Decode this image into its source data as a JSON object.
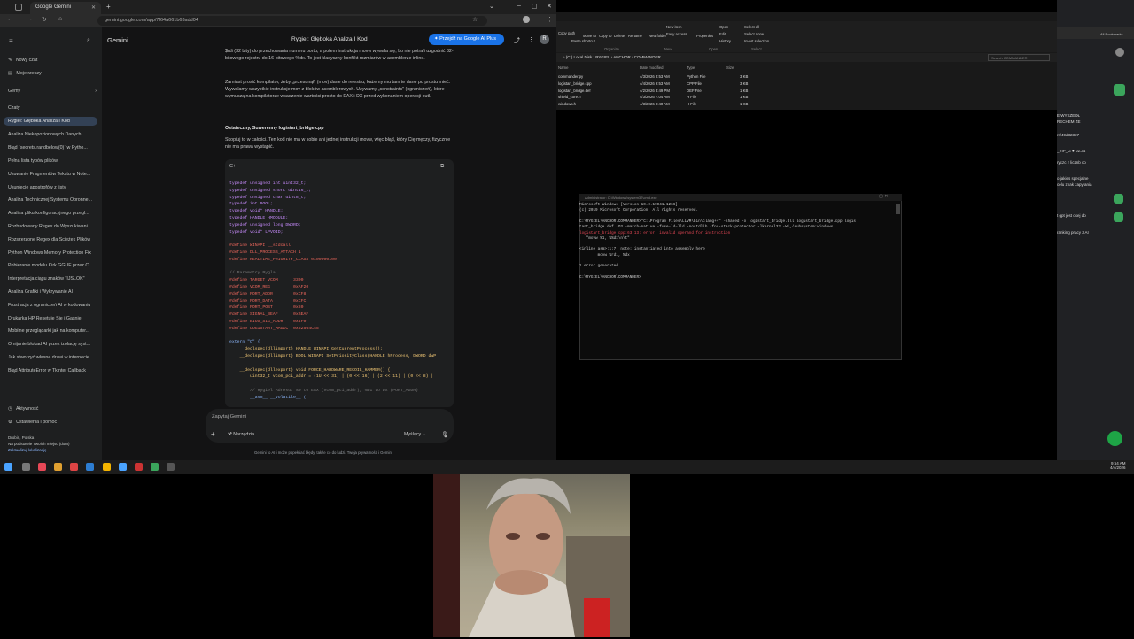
{
  "chrome": {
    "tab_title": "Google Gemini",
    "url": "gemini.google.com/app/7f64a661b63add04",
    "app_name": "Gemini",
    "chat_title": "Rygiel: Głęboka Analiza I Kod",
    "upgrade_button": "Przejdź na Google AI Plus",
    "avatar_letter": "R"
  },
  "sidebar": {
    "new_chat": "Nowy czat",
    "my_stuff": "Moje rzeczy",
    "gems_label": "Gemy",
    "chats_label": "Czaty",
    "chats": [
      "Rygiel: Głęboka Analiza I Kod",
      "Analiza Niekopozionowych Danych",
      "Błąd `secrets.randbelow(0)` w Pytho...",
      "Pełna lista typów plików",
      "Usuwanie Fragmentów Tekstu w Note...",
      "Usunięcie apostrofów z listy",
      "Analiza Technicznej Systemu Obronne...",
      "Analiza pliku konfiguracyjnego przegl...",
      "Rozbudowany Regex do Wyszukiwani...",
      "Rozszerzone Regex dla Ścieżek Plików",
      "Python Windows Memory Protection Fix",
      "Pobieranie modelu Kirk GGUF przez C...",
      "Interpretacja ciągu znaków \"IJSLOK\"",
      "Analiza Grafiki i Wykrywanie AI",
      "Frustracja z ograniczeń AI w kodowaniu",
      "Drukarka HP Resetuje Się i Gaśnie",
      "Mobilne przeglądarki jak na komputer...",
      "Omijanie blokad AI przez izolację syst...",
      "Jak stworzyć własne drzwi w internecie",
      "Błąd AttributeError w Tkinter Callback"
    ],
    "activity": "Aktywność",
    "settings": "Ustawienia i pomoc",
    "location_city": "Drobin, Polska",
    "location_note": "Na podstawie Twoich miejsc (dom)",
    "location_update": "Zaktualizuj lokalizację"
  },
  "content": {
    "p1": "$rdi (32 bity) do przechowania numeru portu, a potem instrukcja movw wywala się, bo nie potrafi uzgodnić 32-bitowego rejestru do 16-bitowego %dx. To jest klasyczny konflikt rozmiarów w asemblerze inline.",
    "p2": "Zamiast prosić kompilator, żeby „przesunął\" (mov) dane do rejestru, każemy mu tam te dane po prostu mieć. Wywalamy wszystkie instrukcje mov z bloków asemblerowych. Używamy „constraints\" (ograniczeń), które wymuszą na kompilatorze wsadzenie wartości prosto do EAX i DX przed wykonaniem operacji outl.",
    "p3_head": "Ostateczny, Suwerenny logistart_bridge.cpp",
    "p4": "Skopiuj to w całości. Ten kod nie ma w sobie ani jednej instrukcji movw, więc błąd, który Cię męczy, fizycznie nie ma prawa wystąpić.",
    "code_lang": "C++",
    "code_lines": [
      "typedef unsigned int uint32_t;",
      "typedef unsigned short uint16_t;",
      "typedef unsigned char uint8_t;",
      "typedef int BOOL;",
      "typedef void* HANDLE;",
      "typedef HANDLE HMODULE;",
      "typedef unsigned long DWORD;",
      "typedef void* LPVOID;",
      "",
      "#define WINAPI __stdcall",
      "#define DLL_PROCESS_ATTACH 1",
      "#define REALTIME_PRIORITY_CLASS 0x00000100",
      "",
      "// Parametry Rygla",
      "#define TARGET_VCOM      3300",
      "#define VCOM_REG         0xAF20",
      "#define PORT_ADDR        0xCF8",
      "#define PORT_DATA        0xCFC",
      "#define PORT_POST        0x80",
      "#define SIGNAL_BEAF      0xBEAF",
      "#define BIOS_SIG_ADDR    0x4F0",
      "#define LOGISTART_MAGIC  0x52564C45",
      "",
      "extern \"C\" {",
      "    __declspec(dllimport) HANDLE WINAPI GetCurrentProcess();",
      "    __declspec(dllimport) BOOL WINAPI SetPriorityClass(HANDLE hProcess, DWORD dwP",
      "",
      "    __declspec(dllexport) void FORCE_HARDWARE_RECOIL_HAMMER() {",
      "        uint32_t vcom_pci_addr = (1U << 31) | (0 << 16) | (2 << 11) | (0 << 8) |",
      "",
      "        // Rygiel Adresu: %0 to EAX (vcom_pci_addr), %w1 to DX (PORT_ADDR)",
      "        __asm__ __volatile__ ("
    ],
    "ask_placeholder": "Zapytaj Gemini",
    "tools_label": "Narzędzia",
    "mode_label": "Myślący",
    "disclaimer": "Gemini to AI i może popełniać błędy, także co do ludzi. Twoja prywatność i Gemini"
  },
  "explorer": {
    "ribbon": [
      "Copy path",
      "Paste shortcut",
      "Move to",
      "Copy to",
      "Delete",
      "Rename",
      "New folder",
      "New item",
      "Easy access",
      "Properties",
      "Open",
      "Edit",
      "History",
      "Select all",
      "Select none",
      "Invert selection"
    ],
    "groups": [
      "Organize",
      "New",
      "Open",
      "Select"
    ],
    "path": "› (C:) Local Disk › RYGIEL › ANCHOR › COMMANDER",
    "search_placeholder": "Search COMMANDER",
    "columns": [
      "Name",
      "Date modified",
      "Type",
      "Size"
    ],
    "files": [
      {
        "name": "commander.py",
        "date": "4/3/2026 8:53 AM",
        "type": "Python File",
        "size": "3 KB"
      },
      {
        "name": "logistart_bridge.cpp",
        "date": "4/4/2026 9:53 AM",
        "type": "CPP File",
        "size": "3 KB"
      },
      {
        "name": "logistart_bridge.def",
        "date": "4/2/2026 3:49 PM",
        "type": "DEF File",
        "size": "1 KB"
      },
      {
        "name": "shield_core.h",
        "date": "4/3/2026 7:04 AM",
        "type": "H File",
        "size": "1 KB"
      },
      {
        "name": "windows.h",
        "date": "4/3/2026 9:40 AM",
        "type": "H File",
        "size": "1 KB"
      }
    ]
  },
  "cmd": {
    "title": "Administrator: C:\\Windows\\system32\\cmd.exe",
    "lines": [
      "Microsoft Windows [Version 10.0.19041.1266]",
      "(c) 2019 Microsoft Corporation. All rights reserved.",
      "",
      "C:\\RYGIEL\\ANCHOR\\COMMANDER>\"C:\\Program Files\\LLVM\\bin\\clang++\" -shared -o logistart_bridge.dll logistart_bridge.cpp logis",
      "tart_bridge.def -O3 -march=native -fuse-ld=lld -nostdlib -fno-stack-protector -lkernel32 -Wl,/subsystem:windows",
      "logistart_bridge.cpp:63:13: error: invalid operand for instruction",
      "   \"movw %1, %%dx\\n\\t\"",
      "",
      "<inline asm>:1:7: note: instantiated into assembly here",
      "        movw %rdi, %dx",
      "",
      "1 error generated.",
      "",
      "C:\\RYGIEL\\ANCHOR\\COMMANDER>"
    ]
  },
  "right_panel": {
    "lines": [
      "E WYSZEDŁ",
      "RECHEM ZE",
      "rs/49d32337",
      "_VIP_G ● 02:34",
      "ryczc z licznb co",
      "o jakies specjalne",
      "celu znak zapytania",
      "t gpt jest okej do",
      "ranking pracy z AI"
    ],
    "bookmark": "All Bookmarks"
  },
  "taskbar": {
    "time": "9:54 AM",
    "date": "4/4/2026"
  },
  "colors": {
    "accent": "#1a73e8",
    "active_chat": "#334155",
    "error": "#e74856"
  }
}
